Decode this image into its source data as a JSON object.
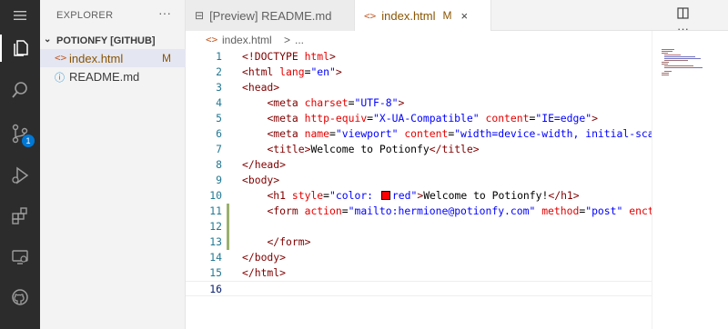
{
  "activity_bar": {
    "icons": [
      "menu-icon",
      "explorer-icon",
      "search-icon",
      "source-control-icon",
      "run-debug-icon",
      "extensions-icon",
      "remote-explorer-icon",
      "github-icon"
    ],
    "source_control_badge": "1"
  },
  "sidebar": {
    "title": "EXPLORER",
    "more": "···",
    "folder": "POTIONFY [GITHUB]",
    "files": [
      {
        "icon": "<>",
        "name": "index.html",
        "badge": "M"
      },
      {
        "icon": "ⓘ",
        "name": "README.md",
        "badge": ""
      }
    ]
  },
  "tabs": [
    {
      "icon": "⊟",
      "label": "[Preview] README.md",
      "badge": "",
      "close": ""
    },
    {
      "icon": "<>",
      "label": "index.html",
      "badge": "M",
      "close": "×"
    }
  ],
  "breadcrumb": {
    "icon": "<>",
    "file": "index.html",
    "sep": ">",
    "more": "..."
  },
  "editor": {
    "lines": [
      "1",
      "2",
      "3",
      "4",
      "5",
      "6",
      "7",
      "8",
      "9",
      "10",
      "11",
      "12",
      "13",
      "14",
      "15",
      "16"
    ],
    "tokens": {
      "l1_a": "<!DOCTYPE ",
      "l1_b": "html",
      "l1_c": ">",
      "l2_a": "<html ",
      "l2_b": "lang",
      "l2_c": "=",
      "l2_d": "\"en\"",
      "l2_e": ">",
      "l3": "<head>",
      "l4_a": "<meta ",
      "l4_b": "charset",
      "l4_c": "=",
      "l4_d": "\"UTF-8\"",
      "l4_e": ">",
      "l5_a": "<meta ",
      "l5_b": "http-equiv",
      "l5_c": "=",
      "l5_d": "\"X-UA-Compatible\"",
      "l5_e": " content",
      "l5_f": "=",
      "l5_g": "\"IE=edge\"",
      "l5_h": ">",
      "l6_a": "<meta ",
      "l6_b": "name",
      "l6_c": "=",
      "l6_d": "\"viewport\"",
      "l6_e": " content",
      "l6_f": "=",
      "l6_g": "\"width=device-width, initial-scal",
      "l7_a": "<title>",
      "l7_b": "Welcome to Potionfy",
      "l7_c": "</title>",
      "l8": "</head>",
      "l9": "<body>",
      "l10_a": "<h1 ",
      "l10_b": "style",
      "l10_c": "=",
      "l10_d": "\"color: ",
      "l10_e": "red\"",
      "l10_f": ">",
      "l10_g": "Welcome to Potionfy!",
      "l10_h": "</h1>",
      "l11_a": "<form ",
      "l11_b": "action",
      "l11_c": "=",
      "l11_d": "\"mailto:hermione@potionfy.com\"",
      "l11_e": " method",
      "l11_f": "=",
      "l11_g": "\"post\"",
      "l11_h": " encty",
      "l13": "</form>",
      "l14": "</body>",
      "l15": "</html>"
    }
  }
}
